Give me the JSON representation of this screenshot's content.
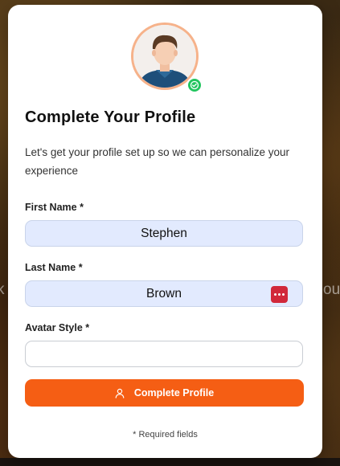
{
  "background": {
    "left_fragment": "k",
    "right_fragment": "ou"
  },
  "profile_form": {
    "title": "Complete Your Profile",
    "subtitle": "Let's get your profile set up so we can personalize your experience",
    "avatar_icon": "user-avatar",
    "status_icon": "check-circle-icon",
    "fields": {
      "first_name": {
        "label": "First Name *",
        "value": "Stephen"
      },
      "last_name": {
        "label": "Last Name *",
        "value": "Brown",
        "trailing_icon": "password-manager-icon"
      },
      "avatar_style": {
        "label": "Avatar Style *",
        "value": ""
      }
    },
    "submit": {
      "label": "Complete Profile",
      "icon": "user-icon"
    },
    "required_note": "* Required fields"
  },
  "colors": {
    "accent": "#f55e14",
    "status": "#22c55e",
    "filled_field": "#e2eafe",
    "avatar_ring": "#f6b28a"
  }
}
